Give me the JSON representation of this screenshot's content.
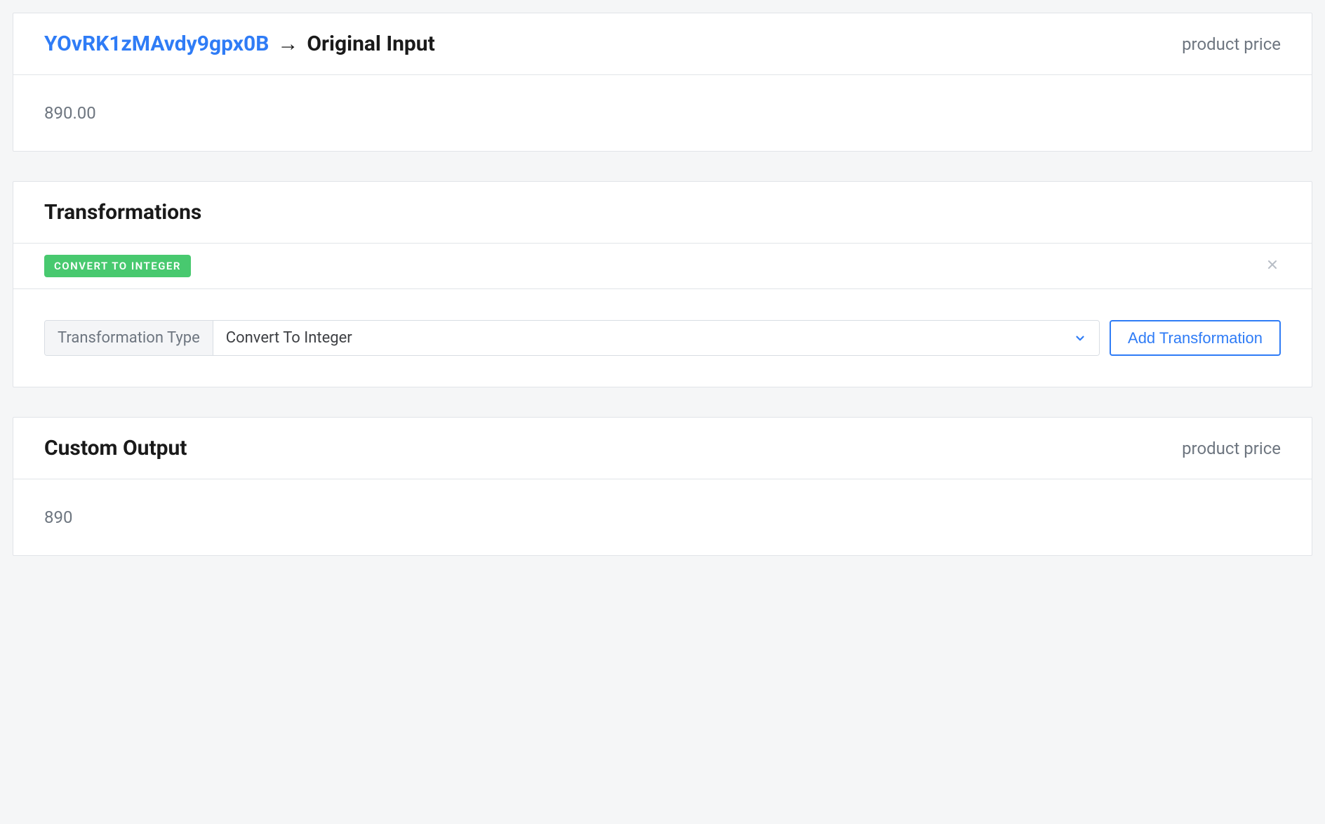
{
  "input_card": {
    "id_link": "YOvRK1zMAvdy9gpx0B",
    "arrow": "→",
    "title": "Original Input",
    "subtitle": "product price",
    "value": "890.00"
  },
  "transformations": {
    "title": "Transformations",
    "applied": [
      {
        "label": "CONVERT TO INTEGER"
      }
    ],
    "type_field": {
      "label": "Transformation Type",
      "selected": "Convert To Integer"
    },
    "add_button": "Add Transformation"
  },
  "output_card": {
    "title": "Custom Output",
    "subtitle": "product price",
    "value": "890"
  }
}
